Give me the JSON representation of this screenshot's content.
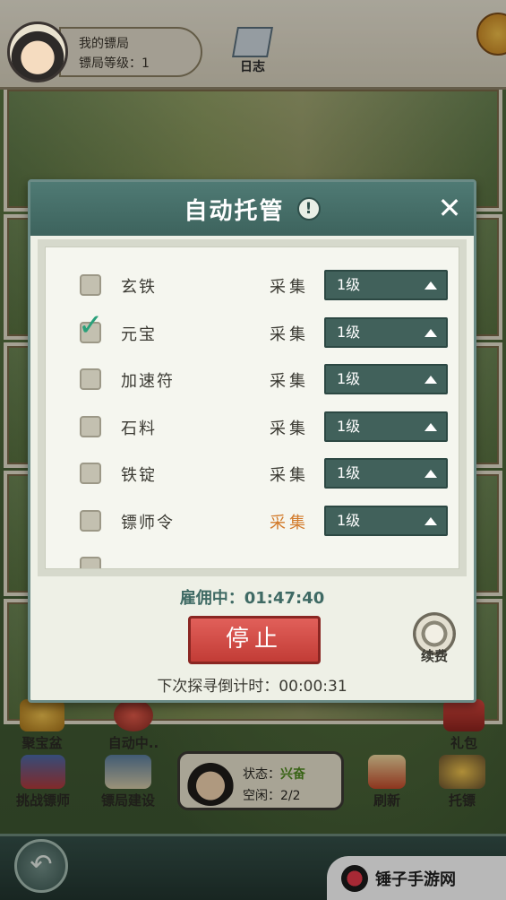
{
  "header": {
    "title": "我的镖局",
    "level_text": "镖局等级：1",
    "journal_label": "日志"
  },
  "bottom": {
    "treasure_label": "聚宝盆",
    "auto_label": "自动中..",
    "gift_label": "礼包",
    "challenge_label": "挑战镖师",
    "build_label": "镖局建设",
    "refresh_label": "刷新",
    "escort_label": "托镖",
    "status_label": "状态：",
    "status_value": "兴奋",
    "idle_label": "空闲：",
    "idle_value": "2/2"
  },
  "dialog": {
    "title": "自动托管",
    "close_icon": "close-icon",
    "info_icon": "info-icon",
    "items": [
      {
        "name": "玄铁",
        "checked": false,
        "action": "采集",
        "level": "1级",
        "active": false
      },
      {
        "name": "元宝",
        "checked": true,
        "action": "采集",
        "level": "1级",
        "active": false
      },
      {
        "name": "加速符",
        "checked": false,
        "action": "采集",
        "level": "1级",
        "active": false
      },
      {
        "name": "石料",
        "checked": false,
        "action": "采集",
        "level": "1级",
        "active": false
      },
      {
        "name": "铁锭",
        "checked": false,
        "action": "采集",
        "level": "1级",
        "active": false
      },
      {
        "name": "镖师令",
        "checked": false,
        "action": "采集",
        "level": "1级",
        "active": true
      }
    ],
    "hire_text": "雇佣中：01:47:40",
    "stop_label": "停止",
    "renew_label": "续费",
    "next_search_text": "下次探寻倒计时：00:00:31"
  },
  "watermark": {
    "text": "锤子手游网"
  },
  "colors": {
    "header_teal": "#4f7a74",
    "level_btn": "#41615b",
    "stop_red": "#c23c36",
    "active_orange": "#d27a2a",
    "check_green": "#2aa07a"
  }
}
